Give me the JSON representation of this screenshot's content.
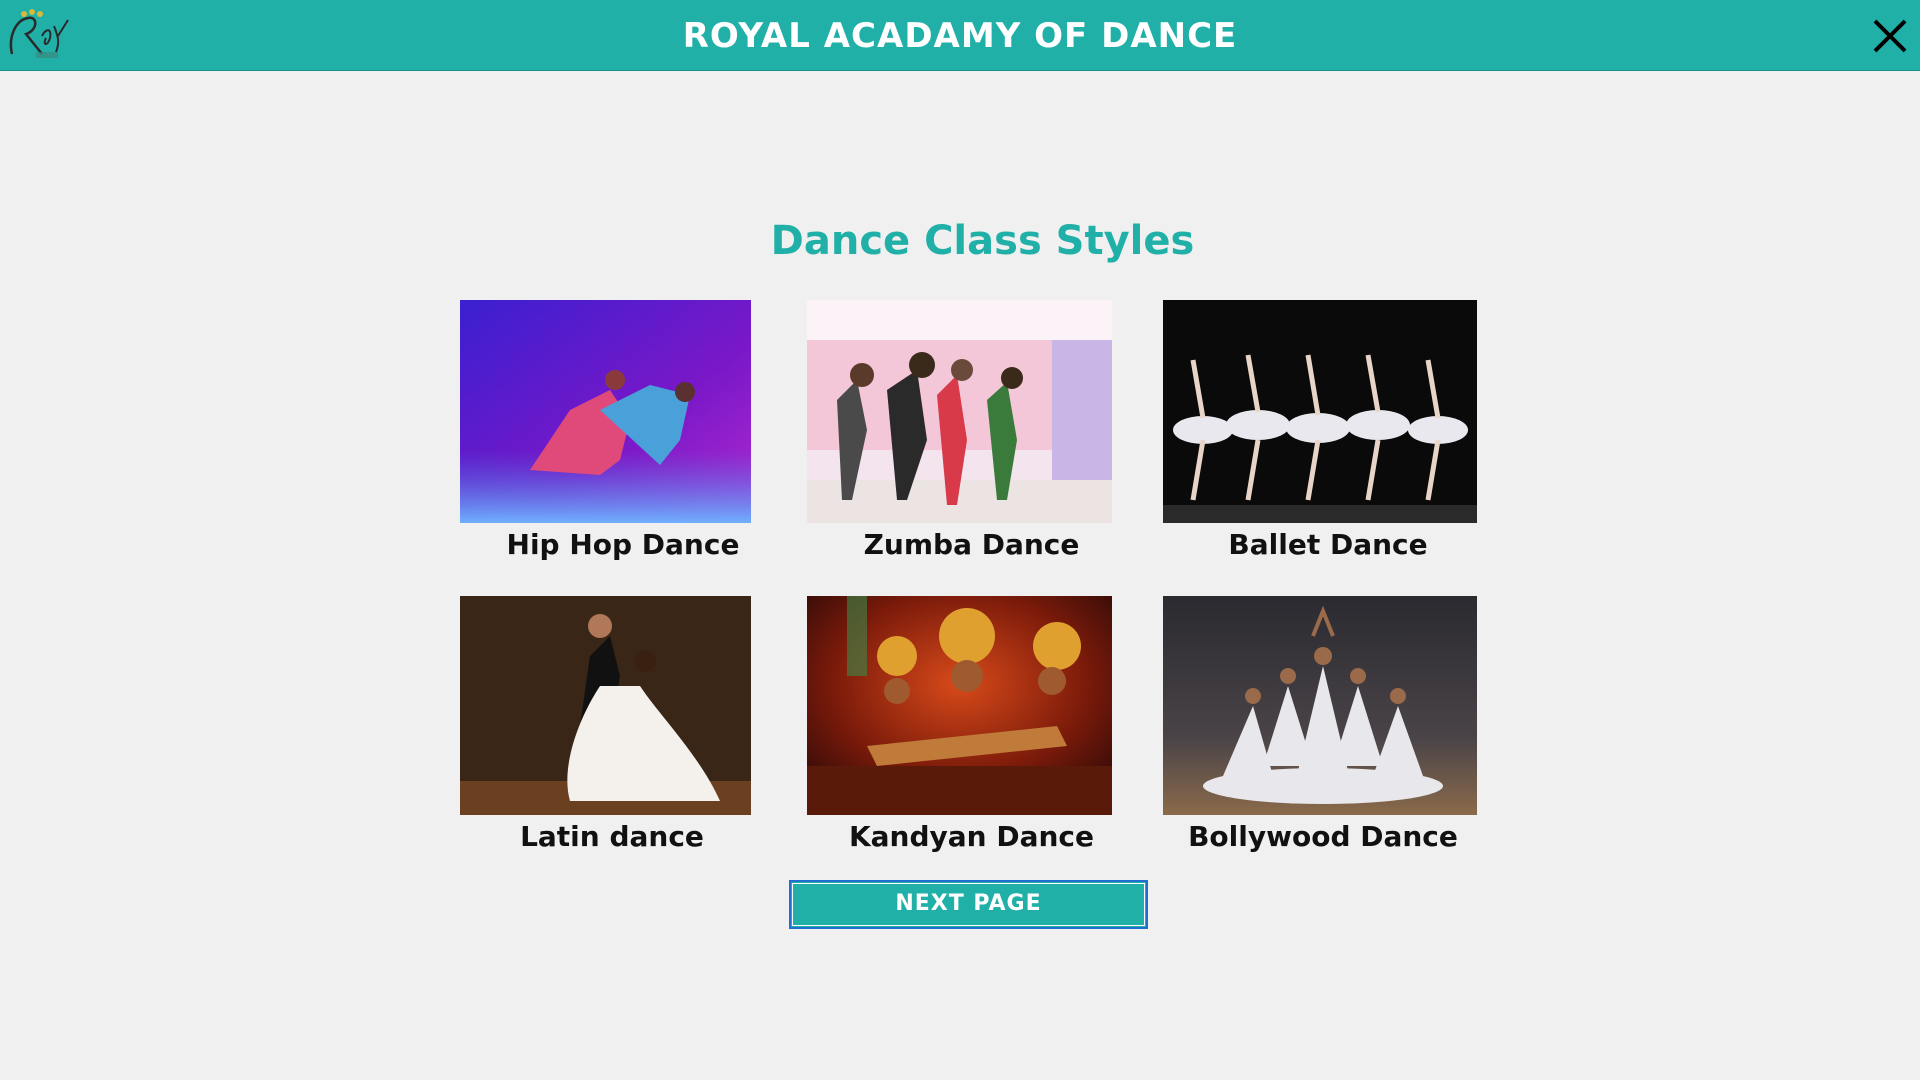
{
  "window": {
    "title": "ROYAL ACADAMY OF DANCE",
    "logo_text": "Royal",
    "close_icon": "close-icon"
  },
  "main": {
    "heading": "Dance Class Styles",
    "cards": [
      {
        "label": "Hip Hop Dance",
        "image": "hip-hop-dancers-photo"
      },
      {
        "label": "Zumba Dance",
        "image": "zumba-dancers-photo"
      },
      {
        "label": "Ballet Dance",
        "image": "ballet-dancers-photo"
      },
      {
        "label": "Latin dance",
        "image": "latin-dance-couple-photo"
      },
      {
        "label": "Kandyan Dance",
        "image": "kandyan-dancers-photo"
      },
      {
        "label": "Bollywood Dance",
        "image": "bollywood-dancers-photo"
      }
    ],
    "next_button": "NEXT PAGE"
  },
  "colors": {
    "accent": "#21b0a8",
    "background": "#f0f0f0",
    "button_border": "#1f6fd0"
  }
}
